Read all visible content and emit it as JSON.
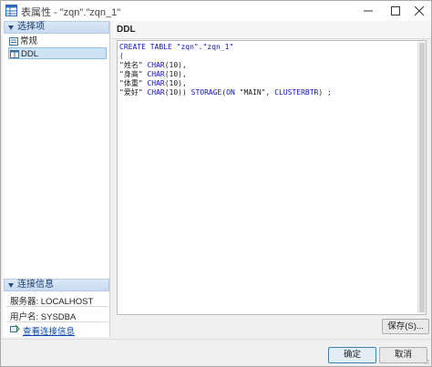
{
  "window": {
    "title": "表属性 - \"zqn\".\"zqn_1\"",
    "title_icon": "table-icon"
  },
  "left": {
    "selection_header": "选择项",
    "items": [
      {
        "label": "常规",
        "icon": "properties-icon"
      },
      {
        "label": "DDL",
        "icon": "ddl-icon"
      }
    ],
    "connection_header": "连接信息",
    "server": "服务器: LOCALHOST",
    "user": "用户名: SYSDBA",
    "view_connection": "查看连接信息"
  },
  "right": {
    "title": "DDL",
    "ddl_lines": [
      "CREATE TABLE \"zqn\".\"zqn_1\"",
      "(",
      "\"姓名\" CHAR(10),",
      "\"身高\" CHAR(10),",
      "\"体重\" CHAR(10),",
      "\"爱好\" CHAR(10)) STORAGE(ON \"MAIN\", CLUSTERBTR) ;"
    ],
    "save_label": "保存(S)..."
  },
  "buttons": {
    "ok": "确定",
    "cancel": "取消"
  },
  "colors": {
    "keyword": "#1010c8",
    "header_bg": "#c7daf0",
    "selected_bg": "#cde4f7"
  }
}
